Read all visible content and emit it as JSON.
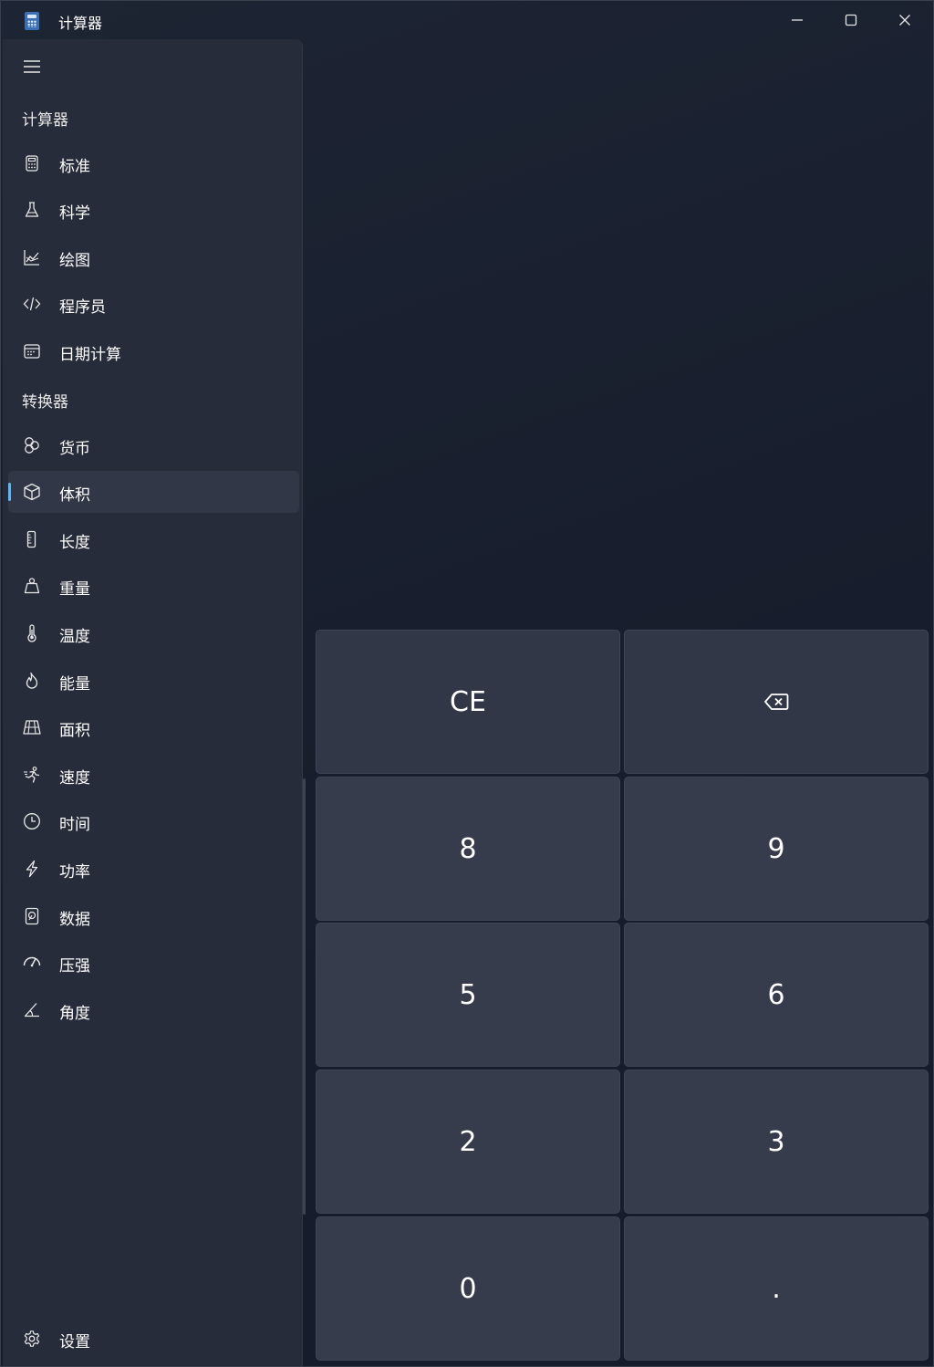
{
  "window": {
    "title": "计算器"
  },
  "sidebar": {
    "calculators_header": "计算器",
    "calculators": [
      {
        "label": "标准",
        "icon": "calculator-icon"
      },
      {
        "label": "科学",
        "icon": "flask-icon"
      },
      {
        "label": "绘图",
        "icon": "graph-icon"
      },
      {
        "label": "程序员",
        "icon": "code-icon"
      },
      {
        "label": "日期计算",
        "icon": "calendar-icon"
      }
    ],
    "converters_header": "转换器",
    "converters": [
      {
        "label": "货币",
        "icon": "currency-icon"
      },
      {
        "label": "体积",
        "icon": "cube-icon",
        "selected": true
      },
      {
        "label": "长度",
        "icon": "ruler-icon"
      },
      {
        "label": "重量",
        "icon": "weight-icon"
      },
      {
        "label": "温度",
        "icon": "thermometer-icon"
      },
      {
        "label": "能量",
        "icon": "fire-icon"
      },
      {
        "label": "面积",
        "icon": "area-grid-icon"
      },
      {
        "label": "速度",
        "icon": "speed-runner-icon"
      },
      {
        "label": "时间",
        "icon": "clock-icon"
      },
      {
        "label": "功率",
        "icon": "lightning-icon"
      },
      {
        "label": "数据",
        "icon": "data-icon"
      },
      {
        "label": "压强",
        "icon": "gauge-icon"
      },
      {
        "label": "角度",
        "icon": "angle-icon"
      }
    ],
    "settings_label": "设置"
  },
  "keypad": {
    "clear_entry": "CE",
    "keys": [
      "8",
      "9",
      "5",
      "6",
      "2",
      "3",
      "0",
      "."
    ]
  },
  "colors": {
    "accent": "#5cb8f5",
    "key_background": "#363c4c",
    "sidebar_background": "#262c39"
  }
}
